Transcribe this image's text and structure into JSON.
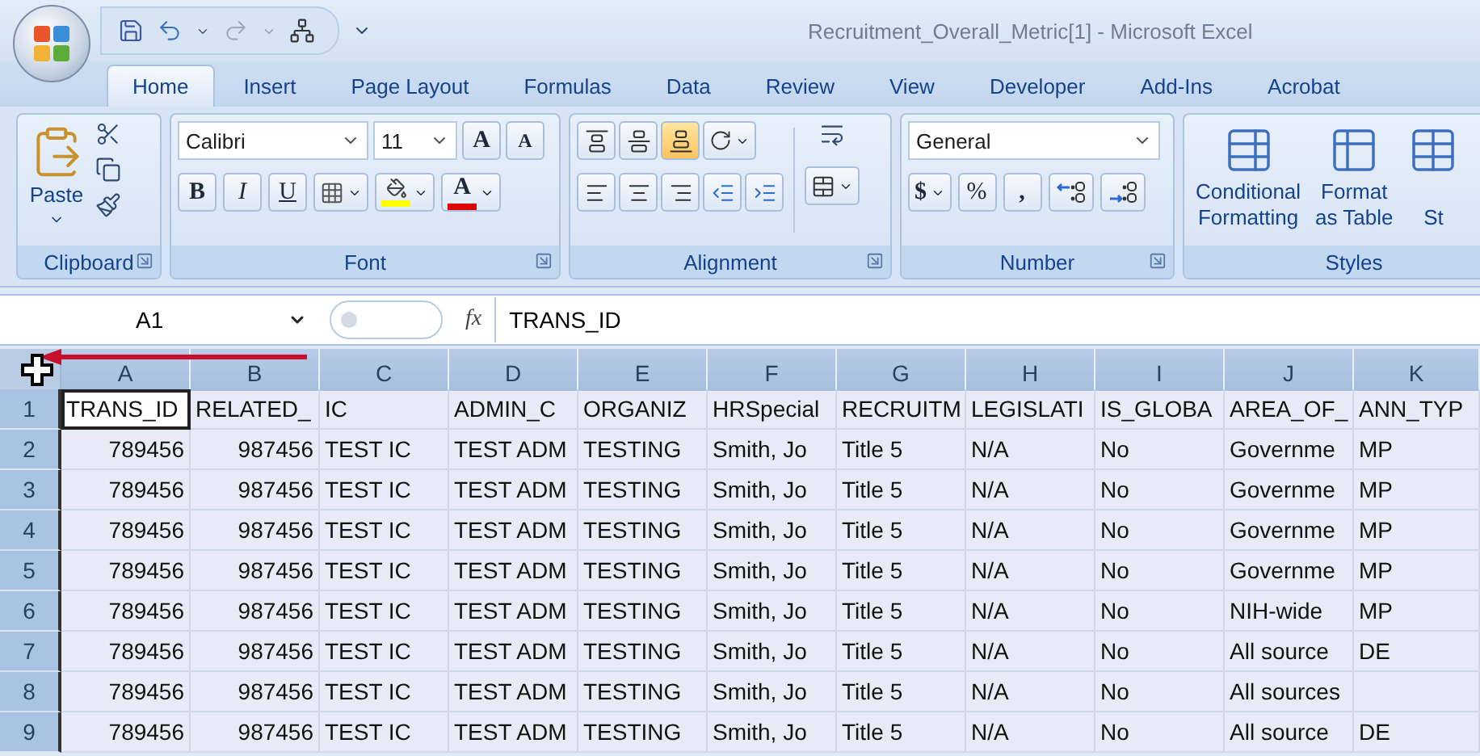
{
  "window": {
    "title": "Recruitment_Overall_Metric[1] - Microsoft Excel"
  },
  "tabs": [
    {
      "label": "Home",
      "selected": true
    },
    {
      "label": "Insert",
      "selected": false
    },
    {
      "label": "Page Layout",
      "selected": false
    },
    {
      "label": "Formulas",
      "selected": false
    },
    {
      "label": "Data",
      "selected": false
    },
    {
      "label": "Review",
      "selected": false
    },
    {
      "label": "View",
      "selected": false
    },
    {
      "label": "Developer",
      "selected": false
    },
    {
      "label": "Add-Ins",
      "selected": false
    },
    {
      "label": "Acrobat",
      "selected": false
    }
  ],
  "ribbon": {
    "groups": [
      {
        "kind": "clipboard",
        "label": "Clipboard",
        "paste": "Paste"
      },
      {
        "kind": "font",
        "label": "Font",
        "font_name": "Calibri",
        "font_size": "11",
        "grow": "A",
        "shrink": "A",
        "bold": "B",
        "italic": "I",
        "underline": "U",
        "font_color": "A"
      },
      {
        "kind": "alignment",
        "label": "Alignment",
        "vertical": [
          {
            "selected": false
          },
          {
            "selected": false
          },
          {
            "selected": true
          }
        ]
      },
      {
        "kind": "number",
        "label": "Number",
        "format": "General",
        "currency": "$",
        "percent": "%",
        "comma": ","
      },
      {
        "kind": "styles",
        "label": "Styles",
        "buttons": [
          {
            "lines": [
              "Conditional",
              "Formatting"
            ]
          },
          {
            "lines": [
              "Format",
              "as Table"
            ]
          },
          {
            "lines": [
              "St"
            ]
          }
        ]
      }
    ]
  },
  "formula_bar": {
    "name_box": "A1",
    "fx": "fx",
    "formula": "TRANS_ID"
  },
  "sheet": {
    "columns": [
      "A",
      "B",
      "C",
      "D",
      "E",
      "F",
      "G",
      "H",
      "I",
      "J",
      "K"
    ],
    "rows": [
      {
        "number": "1",
        "cells": [
          {
            "text": "TRANS_ID",
            "kind": "text",
            "selected": true
          },
          {
            "text": "RELATED_",
            "kind": "text",
            "selected": false
          },
          {
            "text": "IC",
            "kind": "text",
            "selected": false
          },
          {
            "text": "ADMIN_C",
            "kind": "text",
            "selected": false
          },
          {
            "text": "ORGANIZ",
            "kind": "text",
            "selected": false
          },
          {
            "text": "HRSpecial",
            "kind": "text",
            "selected": false
          },
          {
            "text": "RECRUITM",
            "kind": "text",
            "selected": false
          },
          {
            "text": "LEGISLATI",
            "kind": "text",
            "selected": false
          },
          {
            "text": "IS_GLOBA",
            "kind": "text",
            "selected": false
          },
          {
            "text": "AREA_OF_",
            "kind": "text",
            "selected": false
          },
          {
            "text": "ANN_TYP",
            "kind": "text",
            "selected": false
          }
        ]
      },
      {
        "number": "2",
        "cells": [
          {
            "text": "789456",
            "kind": "number",
            "selected": false
          },
          {
            "text": "987456",
            "kind": "number",
            "selected": false
          },
          {
            "text": "TEST IC",
            "kind": "text",
            "selected": false
          },
          {
            "text": "TEST ADM",
            "kind": "text",
            "selected": false
          },
          {
            "text": "TESTING",
            "kind": "text",
            "selected": false
          },
          {
            "text": "Smith, Jo",
            "kind": "text",
            "selected": false
          },
          {
            "text": "Title 5",
            "kind": "text",
            "selected": false
          },
          {
            "text": "N/A",
            "kind": "text",
            "selected": false
          },
          {
            "text": "No",
            "kind": "text",
            "selected": false
          },
          {
            "text": "Governme",
            "kind": "text",
            "selected": false
          },
          {
            "text": "MP",
            "kind": "text",
            "selected": false
          }
        ]
      },
      {
        "number": "3",
        "cells": [
          {
            "text": "789456",
            "kind": "number",
            "selected": false
          },
          {
            "text": "987456",
            "kind": "number",
            "selected": false
          },
          {
            "text": "TEST IC",
            "kind": "text",
            "selected": false
          },
          {
            "text": "TEST ADM",
            "kind": "text",
            "selected": false
          },
          {
            "text": "TESTING",
            "kind": "text",
            "selected": false
          },
          {
            "text": "Smith, Jo",
            "kind": "text",
            "selected": false
          },
          {
            "text": "Title 5",
            "kind": "text",
            "selected": false
          },
          {
            "text": "N/A",
            "kind": "text",
            "selected": false
          },
          {
            "text": "No",
            "kind": "text",
            "selected": false
          },
          {
            "text": "Governme",
            "kind": "text",
            "selected": false
          },
          {
            "text": "MP",
            "kind": "text",
            "selected": false
          }
        ]
      },
      {
        "number": "4",
        "cells": [
          {
            "text": "789456",
            "kind": "number",
            "selected": false
          },
          {
            "text": "987456",
            "kind": "number",
            "selected": false
          },
          {
            "text": "TEST IC",
            "kind": "text",
            "selected": false
          },
          {
            "text": "TEST ADM",
            "kind": "text",
            "selected": false
          },
          {
            "text": "TESTING",
            "kind": "text",
            "selected": false
          },
          {
            "text": "Smith, Jo",
            "kind": "text",
            "selected": false
          },
          {
            "text": "Title 5",
            "kind": "text",
            "selected": false
          },
          {
            "text": "N/A",
            "kind": "text",
            "selected": false
          },
          {
            "text": "No",
            "kind": "text",
            "selected": false
          },
          {
            "text": "Governme",
            "kind": "text",
            "selected": false
          },
          {
            "text": "MP",
            "kind": "text",
            "selected": false
          }
        ]
      },
      {
        "number": "5",
        "cells": [
          {
            "text": "789456",
            "kind": "number",
            "selected": false
          },
          {
            "text": "987456",
            "kind": "number",
            "selected": false
          },
          {
            "text": "TEST IC",
            "kind": "text",
            "selected": false
          },
          {
            "text": "TEST ADM",
            "kind": "text",
            "selected": false
          },
          {
            "text": "TESTING",
            "kind": "text",
            "selected": false
          },
          {
            "text": "Smith, Jo",
            "kind": "text",
            "selected": false
          },
          {
            "text": "Title 5",
            "kind": "text",
            "selected": false
          },
          {
            "text": "N/A",
            "kind": "text",
            "selected": false
          },
          {
            "text": "No",
            "kind": "text",
            "selected": false
          },
          {
            "text": "Governme",
            "kind": "text",
            "selected": false
          },
          {
            "text": "MP",
            "kind": "text",
            "selected": false
          }
        ]
      },
      {
        "number": "6",
        "cells": [
          {
            "text": "789456",
            "kind": "number",
            "selected": false
          },
          {
            "text": "987456",
            "kind": "number",
            "selected": false
          },
          {
            "text": "TEST IC",
            "kind": "text",
            "selected": false
          },
          {
            "text": "TEST ADM",
            "kind": "text",
            "selected": false
          },
          {
            "text": "TESTING",
            "kind": "text",
            "selected": false
          },
          {
            "text": "Smith, Jo",
            "kind": "text",
            "selected": false
          },
          {
            "text": "Title 5",
            "kind": "text",
            "selected": false
          },
          {
            "text": "N/A",
            "kind": "text",
            "selected": false
          },
          {
            "text": "No",
            "kind": "text",
            "selected": false
          },
          {
            "text": "NIH-wide",
            "kind": "text",
            "selected": false
          },
          {
            "text": "MP",
            "kind": "text",
            "selected": false
          }
        ]
      },
      {
        "number": "7",
        "cells": [
          {
            "text": "789456",
            "kind": "number",
            "selected": false
          },
          {
            "text": "987456",
            "kind": "number",
            "selected": false
          },
          {
            "text": "TEST IC",
            "kind": "text",
            "selected": false
          },
          {
            "text": "TEST ADM",
            "kind": "text",
            "selected": false
          },
          {
            "text": "TESTING",
            "kind": "text",
            "selected": false
          },
          {
            "text": "Smith, Jo",
            "kind": "text",
            "selected": false
          },
          {
            "text": "Title 5",
            "kind": "text",
            "selected": false
          },
          {
            "text": "N/A",
            "kind": "text",
            "selected": false
          },
          {
            "text": "No",
            "kind": "text",
            "selected": false
          },
          {
            "text": "All source",
            "kind": "text",
            "selected": false
          },
          {
            "text": "DE",
            "kind": "text",
            "selected": false
          }
        ]
      },
      {
        "number": "8",
        "cells": [
          {
            "text": "789456",
            "kind": "number",
            "selected": false
          },
          {
            "text": "987456",
            "kind": "number",
            "selected": false
          },
          {
            "text": "TEST IC",
            "kind": "text",
            "selected": false
          },
          {
            "text": "TEST ADM",
            "kind": "text",
            "selected": false
          },
          {
            "text": "TESTING",
            "kind": "text",
            "selected": false
          },
          {
            "text": "Smith, Jo",
            "kind": "text",
            "selected": false
          },
          {
            "text": "Title 5",
            "kind": "text",
            "selected": false
          },
          {
            "text": "N/A",
            "kind": "text",
            "selected": false
          },
          {
            "text": "No",
            "kind": "text",
            "selected": false
          },
          {
            "text": "All sources",
            "kind": "text",
            "selected": false
          },
          {
            "kind": "empty",
            "selected": false
          }
        ]
      },
      {
        "number": "9",
        "cells": [
          {
            "text": "789456",
            "kind": "number",
            "selected": false
          },
          {
            "text": "987456",
            "kind": "number",
            "selected": false
          },
          {
            "text": "TEST IC",
            "kind": "text",
            "selected": false
          },
          {
            "text": "TEST ADM",
            "kind": "text",
            "selected": false
          },
          {
            "text": "TESTING",
            "kind": "text",
            "selected": false
          },
          {
            "text": "Smith, Jo",
            "kind": "text",
            "selected": false
          },
          {
            "text": "Title 5",
            "kind": "text",
            "selected": false
          },
          {
            "text": "N/A",
            "kind": "text",
            "selected": false
          },
          {
            "text": "No",
            "kind": "text",
            "selected": false
          },
          {
            "text": "All source",
            "kind": "text",
            "selected": false
          },
          {
            "text": "DE",
            "kind": "text",
            "selected": false
          }
        ]
      }
    ]
  }
}
